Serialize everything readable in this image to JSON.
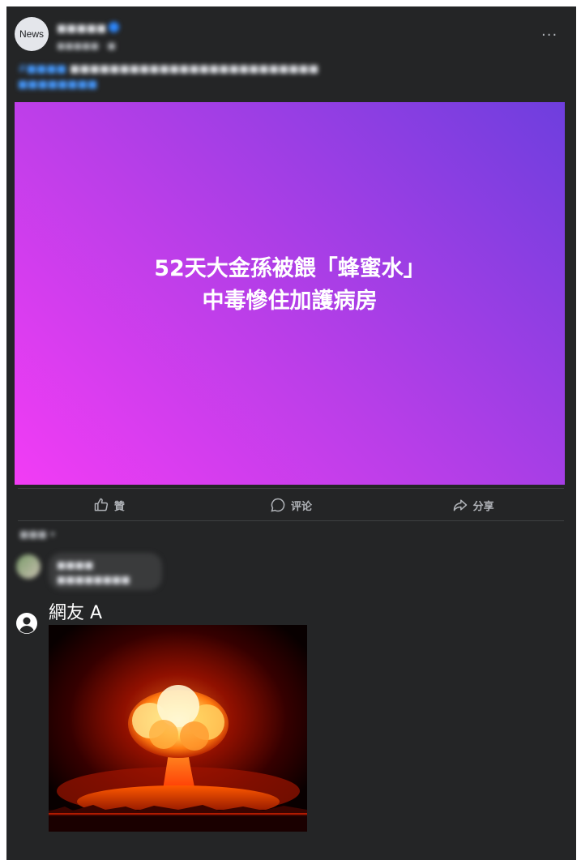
{
  "post": {
    "avatar_text": "News",
    "page_name": "■■■■■",
    "time": "■■■■■ · ■",
    "caption_link": "#■■■■",
    "caption_text": "■■■■■■■■■■■■■■■■■■■■■■■■■",
    "caption_link2": "■■■■■■■■",
    "more_icon": "···"
  },
  "media": {
    "headline_line1": "52天大金孫被餵「蜂蜜水」",
    "headline_line2": "中毒慘住加護病房"
  },
  "actions": {
    "like": "贊",
    "comment": "评论",
    "share": "分享"
  },
  "comments": {
    "sort_label": "■■■ ▾",
    "first_name": "■■■■",
    "first_text": "■■■■■■■■",
    "netizen_name": "網友 A"
  }
}
